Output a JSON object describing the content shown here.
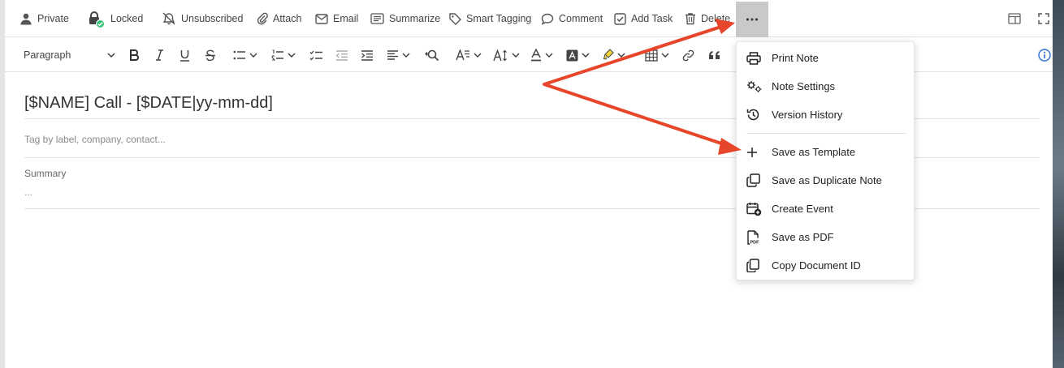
{
  "toolbar": {
    "private_label": "Private",
    "locked_label": "Locked",
    "unsubscribed_label": "Unsubscribed",
    "attach_label": "Attach",
    "email_label": "Email",
    "summarize_label": "Summarize",
    "smart_tagging_label": "Smart Tagging",
    "comment_label": "Comment",
    "add_task_label": "Add Task",
    "delete_label": "Delete"
  },
  "format_bar": {
    "paragraph_label": "Paragraph"
  },
  "document": {
    "title": "[$NAME] Call - [$DATE|yy-mm-dd]",
    "tag_placeholder": "Tag by label, company, contact...",
    "summary_label": "Summary",
    "summary_value": "..."
  },
  "menu": {
    "items": [
      {
        "label": "Print Note",
        "icon": "printer-icon"
      },
      {
        "label": "Note Settings",
        "icon": "gears-icon"
      },
      {
        "label": "Version History",
        "icon": "history-icon"
      },
      {
        "label": "Save as Template",
        "icon": "plus-icon"
      },
      {
        "label": "Save as Duplicate Note",
        "icon": "duplicate-icon"
      },
      {
        "label": "Create Event",
        "icon": "calendar-add-icon"
      },
      {
        "label": "Save as PDF",
        "icon": "pdf-icon"
      },
      {
        "label": "Copy Document ID",
        "icon": "copy-icon"
      }
    ]
  },
  "colors": {
    "annotation_arrow": "#e8462a",
    "locked_badge": "#3cc47c",
    "info_icon": "#2f6fd6",
    "more_button_bg": "#c9c9c9"
  }
}
